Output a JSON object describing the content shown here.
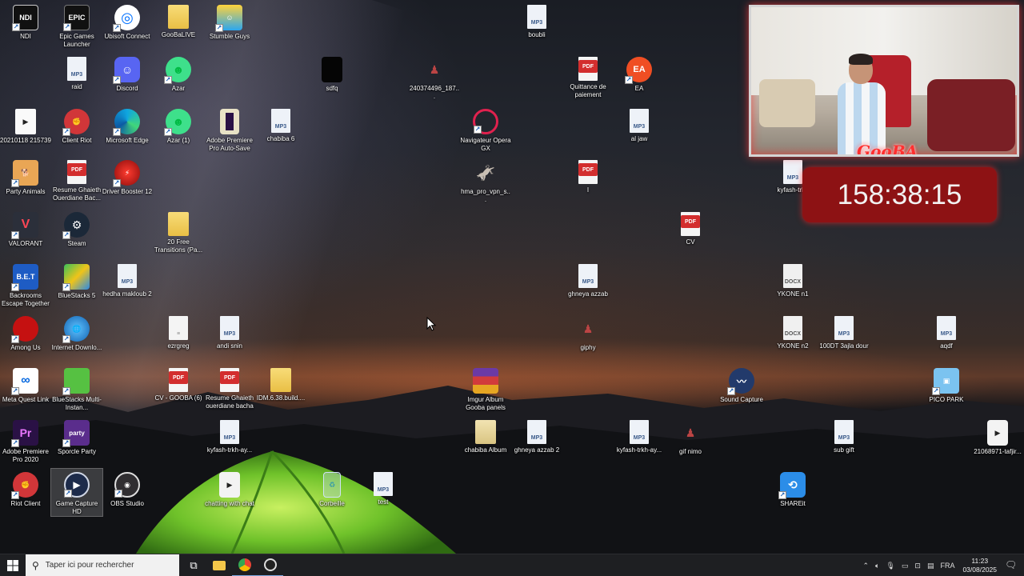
{
  "desktop": {
    "icons": {
      "ndi": "NDI",
      "epic": "Epic Games Launcher",
      "ubisoft": "Ubisoft Connect",
      "goobalive": "GooBaLIVE",
      "stumble": "Stumble Guys",
      "boubli": "boubli",
      "raid": "raid",
      "discord": "Discord",
      "azar": "Azar",
      "sdfq": "sdfq",
      "img240": "240374496_187...",
      "quittance": "Quittance de paiement",
      "ea": "EA",
      "video2021": "20210118 215739",
      "clientriot": "Client Riot",
      "edge": "Microsoft Edge",
      "azar1": "Azar (1)",
      "premiereauto": "Adobe Premiere Pro Auto-Save",
      "chabiba6": "chabiba 6",
      "operagx": "Navigateur Opera GX",
      "aljaw": "al jaw",
      "partyanimals": "Party Animals",
      "resume1": "Resume Ghaieth Ouerdiane Bac...",
      "driverbooster": "Driver Booster 12",
      "hma": "hma_pro_vpn_s...",
      "i": "I",
      "kyfash1": "kyfash-trkh",
      "valorant": "VALORANT",
      "steam": "Steam",
      "transitions": "20 Free Transitions (Pa...",
      "cv": "CV",
      "backrooms": "Backrooms Escape Together",
      "bluestacks5": "BlueStacks 5",
      "hedha": "hedha makloub 2",
      "ghneya": "ghneya azzab",
      "ykone1": "YKONE n1",
      "amongus": "Among Us",
      "idm": "Internet Downlo...",
      "ezrgreg": "ezrgreg",
      "andi": "andi snin",
      "giphy": "giphy",
      "ykone2": "YKONE n2",
      "100dt": "100DT 3ajla dour",
      "aqdf": "aqdf",
      "metaquest": "Meta Quest Link",
      "bsmulti": "BlueStacks Multi-Instan...",
      "cvgooba": "CV - GOOBA (6)",
      "resume2": "Resume Ghaieth ouerdiane bacha",
      "idmbuild": "IDM.6.38.build....",
      "imgur": "Imgur Album Gooba panels",
      "soundcapture": "Sound Capture",
      "picopark": "PICO PARK",
      "premiere2020": "Adobe Premiere Pro 2020",
      "sporcle": "Sporcle Party",
      "kyfash2": "kyfash-trkh-ay...",
      "chabibaalbum": "chabiba Album",
      "ghneya2": "ghneya azzab 2",
      "kyfash3": "kyfash-trkh-ay...",
      "gifnimo": "gif nimo",
      "subgift": "sub gift",
      "video2106": "21068971-tafjir...",
      "riotclient": "Riot Client",
      "gamecapture": "Game Capture HD",
      "obs": "OBS Studio",
      "chatting": "chatting with chat",
      "corbeille": "Corbeille",
      "test": "test",
      "shareit": "SHAREit"
    },
    "badges": {
      "mp3": "MP3",
      "pdf": "PDF",
      "docx": "DOCX",
      "ndi": "NDI",
      "epic": "EPIC",
      "ea": "EA",
      "bet": "B.E.T",
      "pr": "Pr",
      "party": "party"
    }
  },
  "overlay": {
    "webcam_logo": "GooBA",
    "timer": "158:38:15"
  },
  "taskbar": {
    "search_placeholder": "Taper ici pour rechercher",
    "language": "FRA",
    "time": "11:23",
    "date": "03/08/2025"
  },
  "colors": {
    "accent_red": "#8d1214",
    "taskbar": "#1e1f22"
  }
}
